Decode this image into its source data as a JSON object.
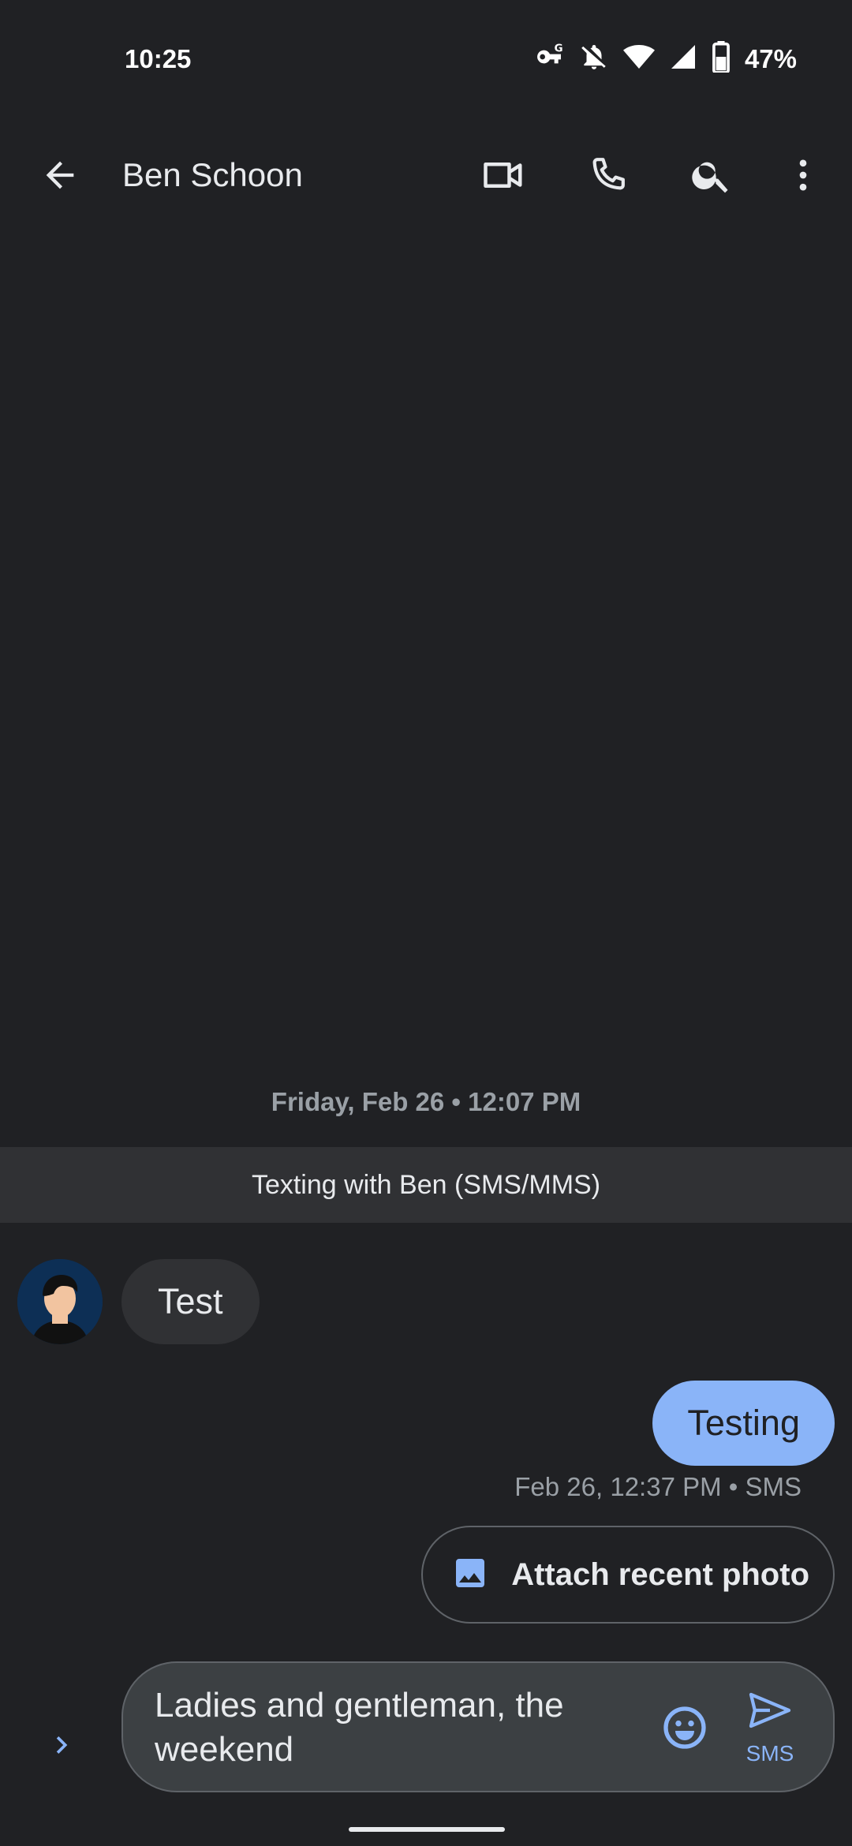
{
  "status_bar": {
    "time": "10:25",
    "battery_percent": "47%",
    "icons": [
      "vpn-key-icon",
      "notifications-off-icon",
      "wifi-icon",
      "cell-signal-icon",
      "battery-icon"
    ]
  },
  "app_bar": {
    "contact_name": "Ben Schoon",
    "icons": [
      "back-arrow-icon",
      "video-call-icon",
      "phone-icon",
      "search-icon",
      "more-vert-icon"
    ]
  },
  "conversation": {
    "date_divider": "Friday, Feb 26 • 12:07 PM",
    "info_banner": "Texting with Ben (SMS/MMS)",
    "incoming": {
      "text": "Test"
    },
    "outgoing": {
      "text": "Testing",
      "meta": "Feb 26, 12:37 PM • SMS"
    },
    "suggestion_chip": {
      "label": "Attach recent photo",
      "icon": "image-icon"
    }
  },
  "compose": {
    "text": "Ladies and gentleman, the weekend",
    "send_label": "SMS",
    "icons": [
      "chevron-right-icon",
      "emoji-icon",
      "send-icon"
    ]
  },
  "colors": {
    "background": "#202124",
    "accent": "#8ab4f8",
    "bubble_incoming": "#303134",
    "bubble_outgoing": "#8ab4f8"
  }
}
